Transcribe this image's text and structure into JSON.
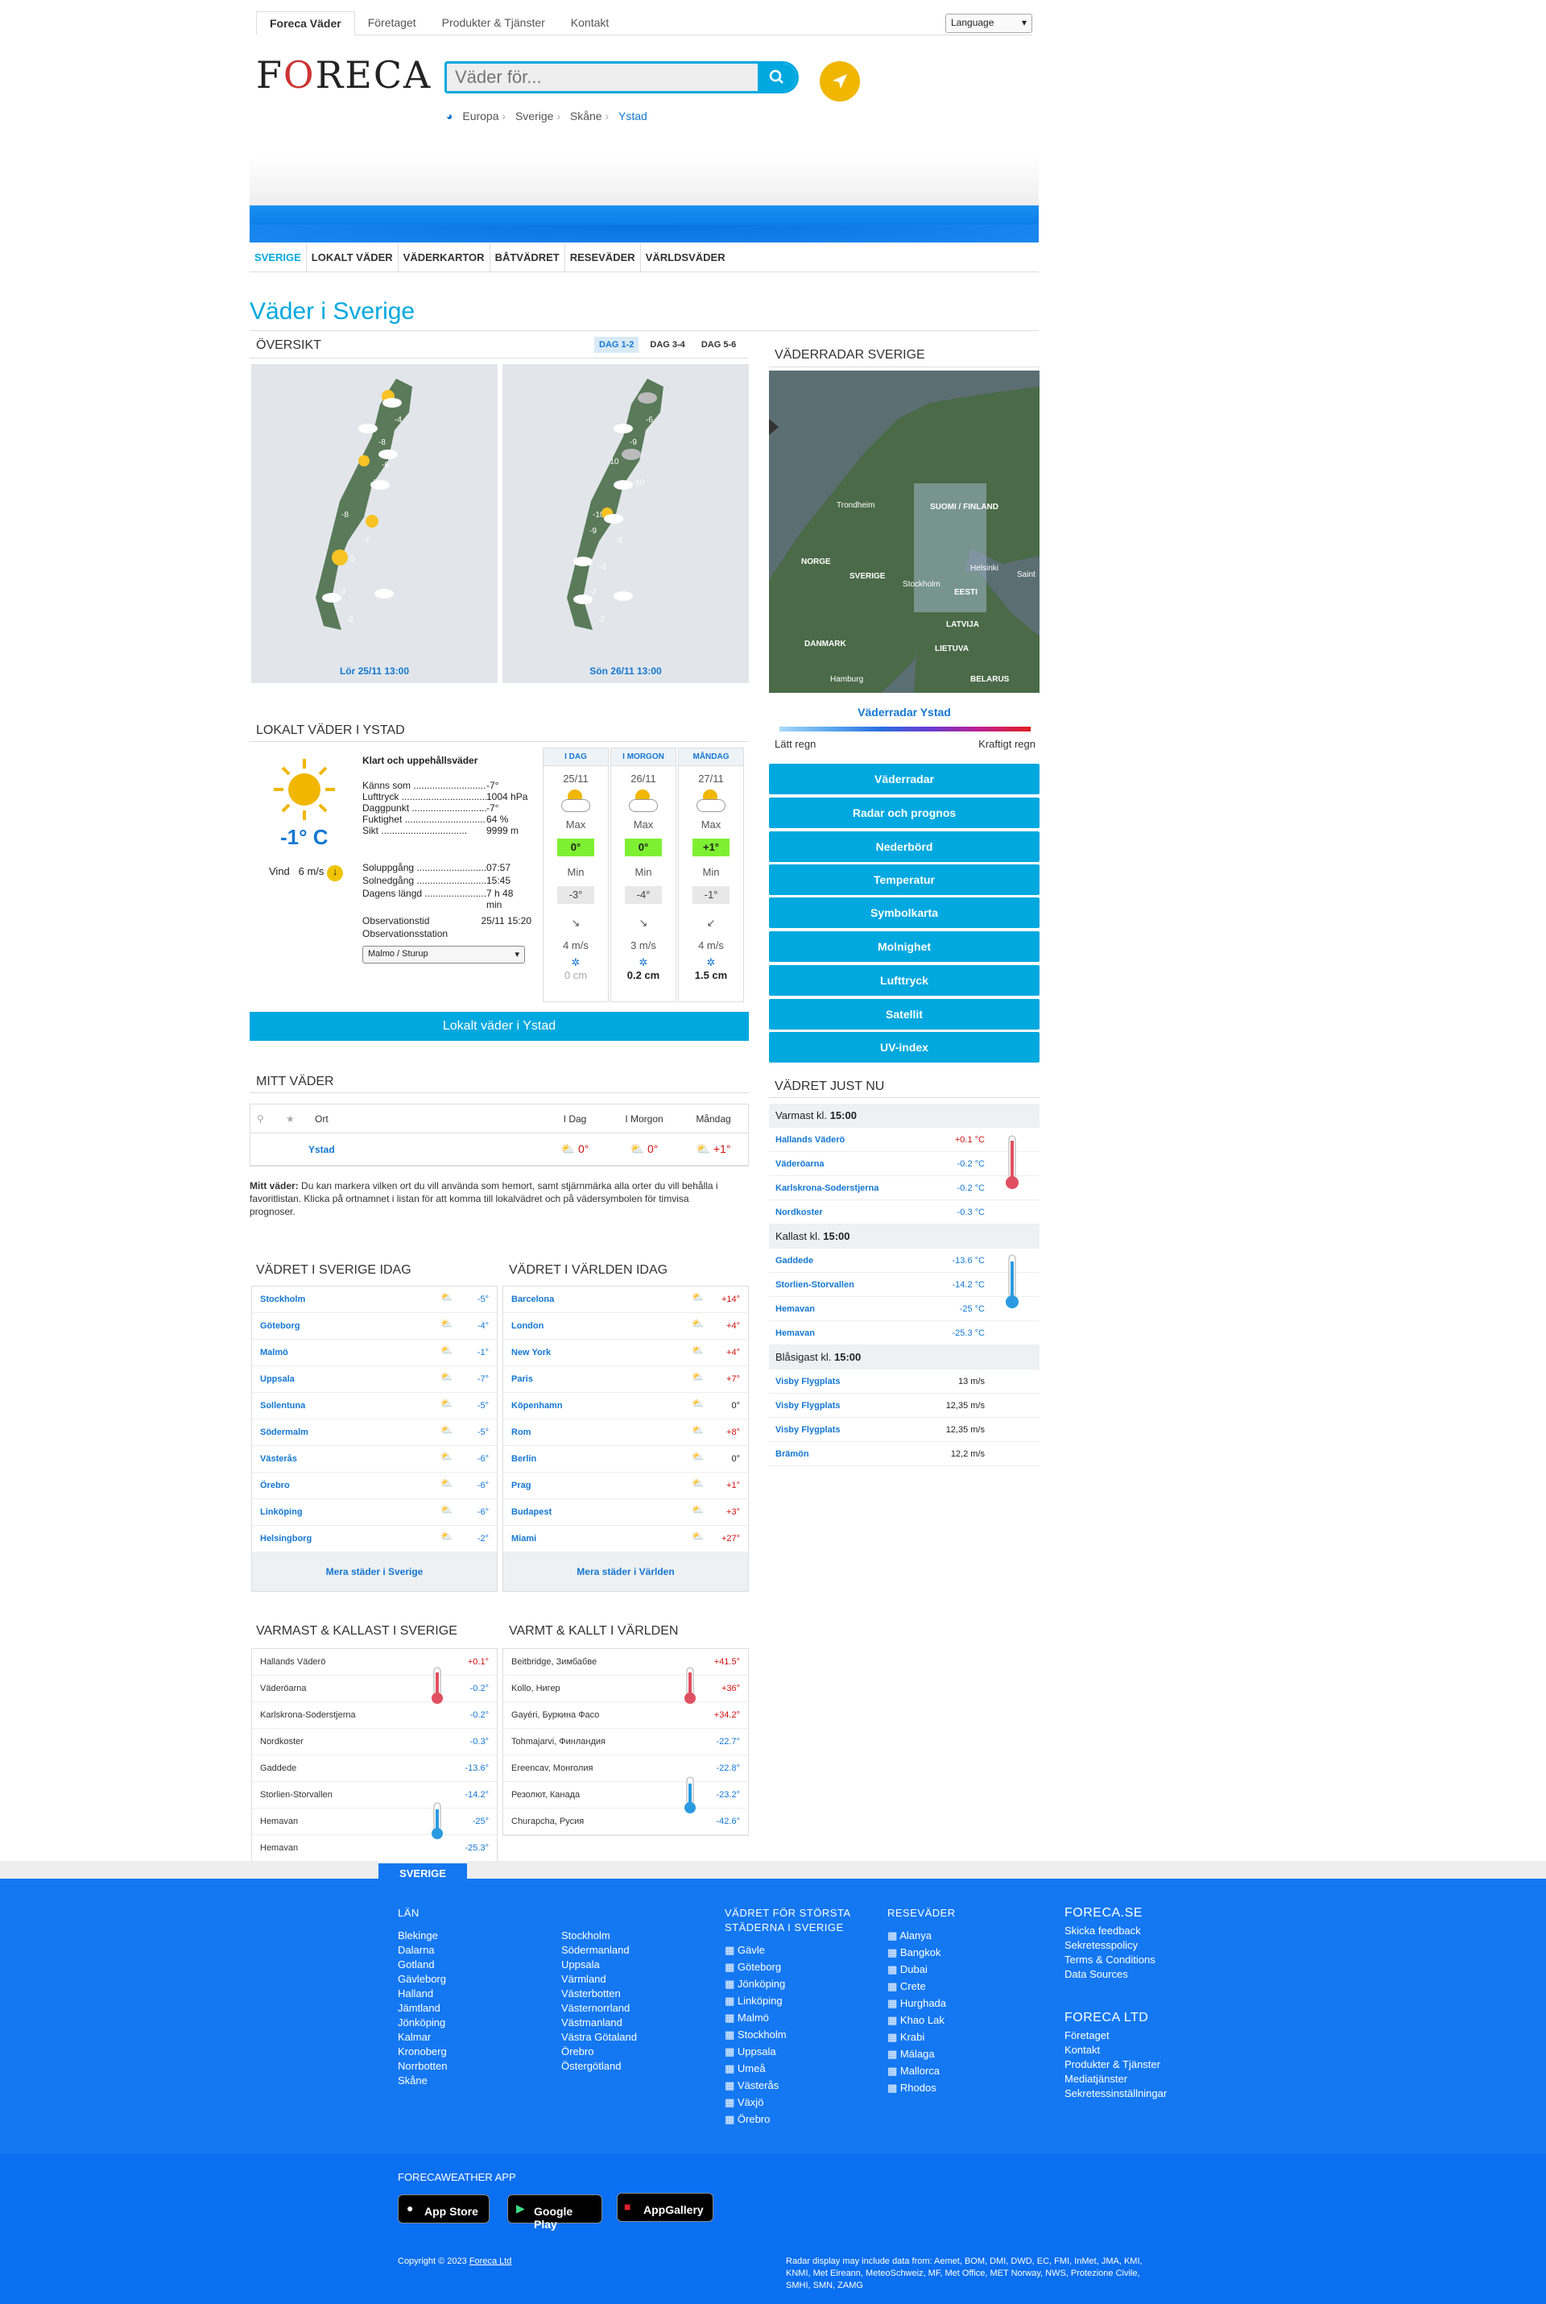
{
  "topnav": {
    "items": [
      "Foreca Väder",
      "Företaget",
      "Produkter & Tjänster",
      "Kontakt"
    ],
    "language": "Language"
  },
  "logo": "FORECA",
  "search": {
    "placeholder": "Väder för..."
  },
  "breadcrumb": [
    "Europa",
    "Sverige",
    "Skåne",
    "Ystad"
  ],
  "subnav": [
    "SVERIGE",
    "LOKALT VÄDER",
    "VÄDERKARTOR",
    "BÅTVÄDRET",
    "RESEVÄDER",
    "VÄRLDSVÄDER"
  ],
  "page_title": "Väder i Sverige",
  "overview": {
    "title": "ÖVERSIKT",
    "tabs": [
      "DAG 1-2",
      "DAG 3-4",
      "DAG 5-6"
    ],
    "maps": [
      {
        "caption": "Lör 25/11 13:00",
        "temps": [
          "-4",
          "-8",
          "-10",
          "-6",
          "-8",
          "-8",
          "-7",
          "-5",
          "-3",
          "-2"
        ]
      },
      {
        "caption": "Sön 26/11 13:00",
        "temps": [
          "-6",
          "-9",
          "-10",
          "-10",
          "-10",
          "-5",
          "-9",
          "-4",
          "-2",
          "-2"
        ]
      }
    ]
  },
  "radar": {
    "title": "VÄDERRADAR SVERIGE",
    "label": "Väderradar Ystad",
    "light": "Lätt regn",
    "heavy": "Kraftigt regn",
    "map_labels": [
      "Trondheim",
      "SUOMI / FINLAND",
      "NORGE",
      "SVERIGE",
      "Helsinki",
      "Stockholm",
      "EESTI",
      "LATVIJA",
      "DANMARK",
      "LIETUVA",
      "Hamburg",
      "BELARUS",
      "Saint"
    ],
    "buttons": [
      "Väderradar",
      "Radar och prognos",
      "Nederbörd",
      "Temperatur",
      "Symbolkarta",
      "Molnighet",
      "Lufttryck",
      "Satellit",
      "UV-index"
    ]
  },
  "local": {
    "title": "LOKALT VÄDER I YSTAD",
    "temp": "-1° C",
    "wind_label": "Vind",
    "wind": "6 m/s",
    "condition": "Klart och uppehållsväder",
    "details": [
      [
        "Känns som",
        "-7°"
      ],
      [
        "Lufttryck",
        "1004 hPa"
      ],
      [
        "Daggpunkt",
        "-7°"
      ],
      [
        "Fuktighet",
        "64 %"
      ],
      [
        "Sikt",
        "9999 m"
      ]
    ],
    "sun": [
      [
        "Soluppgång",
        "07:57"
      ],
      [
        "Solnedgång",
        "15:45"
      ],
      [
        "Dagens längd",
        "7 h 48 min"
      ]
    ],
    "obs_time_label": "Observationstid",
    "obs_time": "25/11 15:20",
    "obs_station_label": "Observationsstation",
    "station": "Malmo / Sturup",
    "days": [
      {
        "h": "I DAG",
        "d": "25/11",
        "max": "0°",
        "min": "-3°",
        "wind": "4 m/s",
        "snow": "0 cm"
      },
      {
        "h": "I MORGON",
        "d": "26/11",
        "max": "0°",
        "min": "-4°",
        "wind": "3 m/s",
        "snow": "0.2 cm"
      },
      {
        "h": "MÅNDAG",
        "d": "27/11",
        "max": "+1°",
        "min": "-1°",
        "wind": "4 m/s",
        "snow": "1.5 cm"
      }
    ],
    "max_label": "Max",
    "min_label": "Min",
    "button": "Lokalt väder i Ystad"
  },
  "mitt": {
    "title": "MITT VÄDER",
    "cols": [
      "Ort",
      "I Dag",
      "I Morgon",
      "Måndag"
    ],
    "row": {
      "city": "Ystad",
      "t1": "0°",
      "t2": "0°",
      "t3": "+1°"
    },
    "note_bold": "Mitt väder:",
    "note": "Du kan markera vilken ort du vill använda som hemort, samt stjärnmärka alla orter du vill behålla i favoritlistan. Klicka på ortnamnet i listan för att komma till lokalvädret och på vädersymbolen för timvisa prognoser."
  },
  "sweden_today": {
    "title": "VÄDRET I SVERIGE IDAG",
    "more": "Mera städer i Sverige",
    "rows": [
      [
        "Stockholm",
        "-5°"
      ],
      [
        "Göteborg",
        "-4°"
      ],
      [
        "Malmö",
        "-1°"
      ],
      [
        "Uppsala",
        "-7°"
      ],
      [
        "Sollentuna",
        "-5°"
      ],
      [
        "Södermalm",
        "-5°"
      ],
      [
        "Västerås",
        "-6°"
      ],
      [
        "Örebro",
        "-6°"
      ],
      [
        "Linköping",
        "-6°"
      ],
      [
        "Helsingborg",
        "-2°"
      ]
    ]
  },
  "world_today": {
    "title": "VÄDRET I VÄRLDEN IDAG",
    "more": "Mera städer i Världen",
    "rows": [
      [
        "Barcelona",
        "+14°"
      ],
      [
        "London",
        "+4°"
      ],
      [
        "New York",
        "+4°"
      ],
      [
        "Paris",
        "+7°"
      ],
      [
        "Köpenhamn",
        "0°"
      ],
      [
        "Rom",
        "+8°"
      ],
      [
        "Berlin",
        "0°"
      ],
      [
        "Prag",
        "+1°"
      ],
      [
        "Budapest",
        "+3°"
      ],
      [
        "Miami",
        "+27°"
      ]
    ]
  },
  "now": {
    "title": "VÄDRET JUST NU",
    "warm_label": "Varmast kl.",
    "cold_label": "Kallast kl.",
    "wind_label": "Blåsigast kl.",
    "time": "15:00",
    "warm": [
      [
        "Hallands Väderö",
        "+0.1 °C"
      ],
      [
        "Väderöarna",
        "-0.2 °C"
      ],
      [
        "Karlskrona-Soderstjerna",
        "-0.2 °C"
      ],
      [
        "Nordkoster",
        "-0.3 °C"
      ]
    ],
    "cold": [
      [
        "Gaddede",
        "-13.6 °C"
      ],
      [
        "Storlien-Storvallen",
        "-14.2 °C"
      ],
      [
        "Hemavan",
        "-25 °C"
      ],
      [
        "Hemavan",
        "-25.3 °C"
      ]
    ],
    "wind": [
      [
        "Visby Flygplats",
        "13 m/s"
      ],
      [
        "Visby Flygplats",
        "12,35 m/s"
      ],
      [
        "Visby Flygplats",
        "12,35 m/s"
      ],
      [
        "Brämön",
        "12,2 m/s"
      ]
    ]
  },
  "se_extremes": {
    "title": "VARMAST & KALLAST I SVERIGE",
    "rows": [
      [
        "Hallands Väderö",
        "",
        "+0.1°"
      ],
      [
        "Väderöarna",
        "",
        "-0.2°"
      ],
      [
        "Karlskrona-Soderstjerna",
        "",
        "-0.2°"
      ],
      [
        "Nordkoster",
        "",
        "-0.3°"
      ],
      [
        "Gaddede",
        "",
        "-13.6°"
      ],
      [
        "Storlien-Storvallen",
        "",
        "-14.2°"
      ],
      [
        "Hemavan",
        "",
        "-25°"
      ],
      [
        "Hemavan",
        "",
        "-25.3°"
      ]
    ]
  },
  "world_extremes": {
    "title": "VARMT & KALLT I VÄRLDEN",
    "rows": [
      [
        "Beitbridge",
        ", Зимбабве",
        "+41.5°"
      ],
      [
        "Kollo",
        ", Нигер",
        "+36°"
      ],
      [
        "Gayéri",
        ", Буркина Фасо",
        "+34.2°"
      ],
      [
        "Tohmajarvi",
        ", Финландия",
        "-22.7°"
      ],
      [
        "Ereencav",
        ", Монголия",
        "-22.8°"
      ],
      [
        "Резолют",
        ", Канада",
        "-23.2°"
      ],
      [
        "Churapcha",
        ", Русия",
        "-42.6°"
      ]
    ]
  },
  "footer": {
    "tab": "SVERIGE",
    "lan_title": "LÄN",
    "lan1": [
      "Blekinge",
      "Dalarna",
      "Gotland",
      "Gävleborg",
      "Halland",
      "Jämtland",
      "Jönköping",
      "Kalmar",
      "Kronoberg",
      "Norrbotten",
      "Skåne"
    ],
    "lan2": [
      "Stockholm",
      "Södermanland",
      "Uppsala",
      "Värmland",
      "Västerbotten",
      "Västernorrland",
      "Västmanland",
      "Västra Götaland",
      "Örebro",
      "Östergötland"
    ],
    "cities_title": "VÄDRET FÖR STÖRSTA STÄDERNA I SVERIGE",
    "cities": [
      "Gävle",
      "Göteborg",
      "Jönköping",
      "Linköping",
      "Malmö",
      "Stockholm",
      "Uppsala",
      "Umeå",
      "Västerås",
      "Växjö",
      "Örebro"
    ],
    "travel_title": "RESEVÄDER",
    "travel": [
      "Alanya",
      "Bangkok",
      "Dubai",
      "Crete",
      "Hurghada",
      "Khao Lak",
      "Krabi",
      "Málaga",
      "Mallorca",
      "Rhodos"
    ],
    "se_title": "FORECA.SE",
    "se": [
      "Skicka feedback",
      "Sekretesspolicy",
      "Terms & Conditions",
      "Data Sources"
    ],
    "ltd_title": "FORECA LTD",
    "ltd": [
      "Företaget",
      "Kontakt",
      "Produkter & Tjänster",
      "Mediatjänster",
      "Sekretessinställningar"
    ],
    "app_title": "FORECAWEATHER APP",
    "stores": [
      "App Store",
      "Google Play",
      "AppGallery"
    ],
    "copyright": "Copyright © 2023",
    "foreca_ltd": "Foreca Ltd",
    "radar_note": "Radar display may include data from: Aemet, BOM, DMI, DWD, EC, FMI, InMet, JMA, KMI, KNMI, Met Eireann, MeteoSchweiz, MF, Met Office, MET Norway, NWS, Protezione Civile, SMHI, SMN, ZAMG"
  },
  "colors": {
    "accent": "#00a8e0",
    "link": "#1477d2",
    "footer": "#1478f2",
    "warm": "#d01010",
    "max_green": "#7ef032"
  }
}
